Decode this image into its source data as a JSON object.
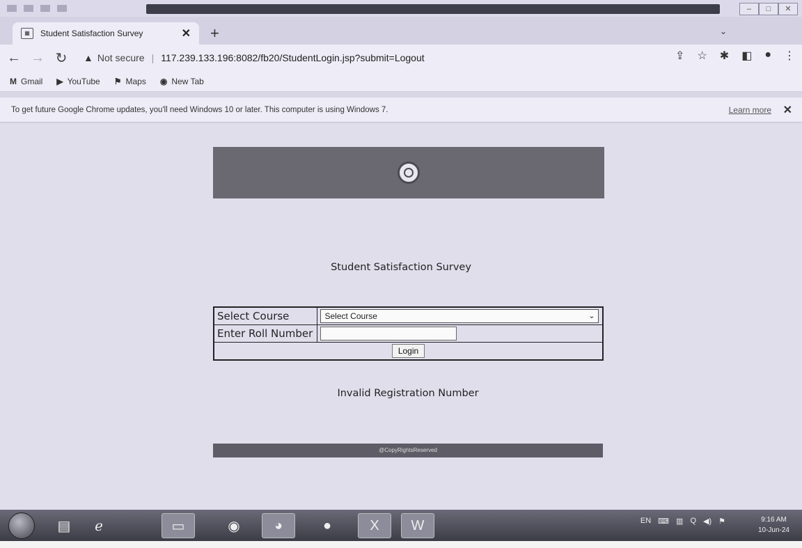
{
  "browser": {
    "tab": {
      "title": "Student Satisfaction Survey"
    },
    "address": {
      "security_label": "Not secure",
      "url": "117.239.133.196:8082/fb20/StudentLogin.jsp?submit=Logout"
    },
    "bookmarks": [
      {
        "label": "Gmail",
        "icon": "gmail-icon"
      },
      {
        "label": "YouTube",
        "icon": "youtube-icon"
      },
      {
        "label": "Maps",
        "icon": "maps-icon"
      },
      {
        "label": "New Tab",
        "icon": "globe-icon"
      }
    ],
    "infobar": {
      "message": "To get future Google Chrome updates, you'll need Windows 10 or later. This computer is using Windows 7.",
      "link": "Learn more"
    }
  },
  "page": {
    "survey_title": "Student Satisfaction Survey",
    "form": {
      "course_label": "Select Course",
      "course_selected": "Select Course",
      "roll_label": "Enter Roll Number",
      "roll_value": "",
      "login_label": "Login"
    },
    "error_message": "Invalid Registration Number",
    "footer": "@CopyRightsReserved"
  },
  "taskbar": {
    "language": "EN",
    "time": "9:16 AM",
    "date": "10-Jun-24"
  }
}
